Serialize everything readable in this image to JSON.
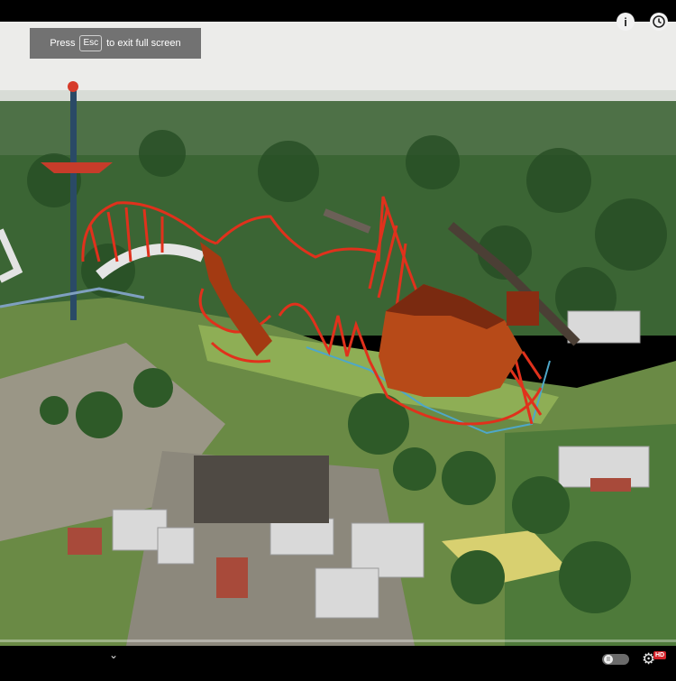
{
  "player": {
    "fullscreen_hint": {
      "prefix": "Press",
      "key": "Esc",
      "suffix": "to exit full screen"
    },
    "info_icon_glyph": "i",
    "clock_icon": "clock-icon",
    "chevron_glyph": "⌄",
    "toggle_glyph": "II",
    "gear_glyph": "⚙",
    "hd_badge": "HD"
  },
  "video": {
    "scene": "aerial-amusement-park-with-roller-coasters",
    "colors": {
      "sky": "#ececea",
      "forest": "#2f5a2a",
      "grass": "#7da24a",
      "drawing": "#e0311c",
      "drawing_fill": "#a33a12"
    }
  }
}
